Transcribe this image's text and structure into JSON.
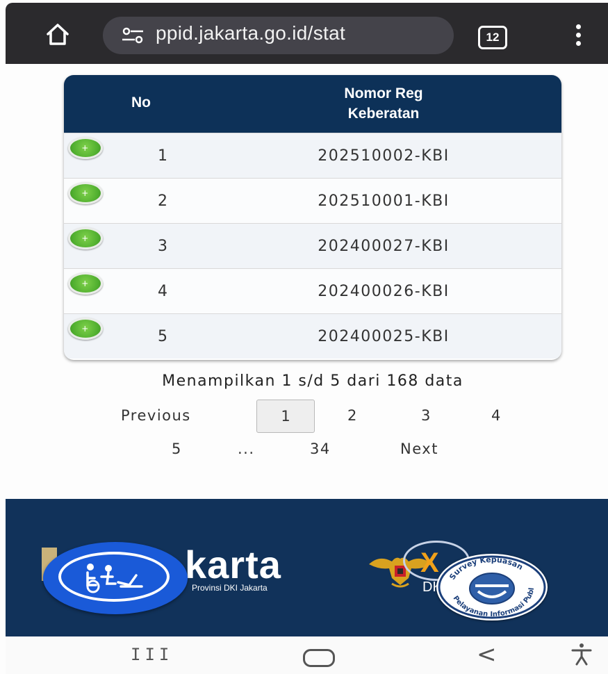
{
  "browser": {
    "url": "ppid.jakarta.go.id/stat",
    "tab_count": "12",
    "icons": [
      "home-icon",
      "site-settings-icon",
      "more-menu-icon"
    ]
  },
  "table": {
    "headers": {
      "no": "No",
      "reg": "Nomor Reg Keberatan"
    },
    "rows": [
      {
        "no": "1",
        "reg": "202510002-KBI"
      },
      {
        "no": "2",
        "reg": "202510001-KBI"
      },
      {
        "no": "3",
        "reg": "202400027-KBI"
      },
      {
        "no": "4",
        "reg": "202400026-KBI"
      },
      {
        "no": "5",
        "reg": "202400025-KBI"
      }
    ],
    "expand_symbol": "+"
  },
  "pagination": {
    "info": "Menampilkan 1 s/d 5 dari 168 data",
    "previous": "Previous",
    "pages": [
      "1",
      "2",
      "3",
      "4",
      "5",
      "...",
      "34"
    ],
    "active_page": "1",
    "next": "Next"
  },
  "footer": {
    "brand_text": "karta",
    "brand_sub": "Provinsi DKI Jakarta",
    "kip_x": "X",
    "dk_text": "DK",
    "survey_badge": "Survey Kepuasan Pelayanan Informasi Publik"
  },
  "android_nav": {
    "recents": "III",
    "back": "<"
  },
  "colors": {
    "header_navy": "#0d3158",
    "footer_navy": "#11325a",
    "expand_green": "#4fae2e",
    "access_blue": "#1a5ad8",
    "kip_orange": "#f2a21a"
  }
}
